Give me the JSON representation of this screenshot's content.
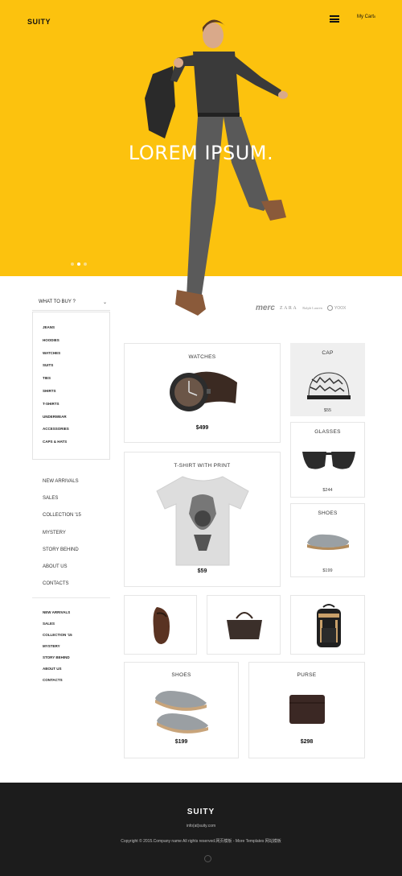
{
  "header": {
    "logo": "SUITY",
    "cart_label": "My Cart",
    "cart_count": "0"
  },
  "hero": {
    "title": "LOREM IPSUM.",
    "slides": 3,
    "active_slide": 2,
    "background_color": "#fcc20e"
  },
  "sidebar": {
    "dropdown_label": "WHAT TO BUY ?",
    "categories": [
      "JEANS",
      "HOODIES",
      "WATCHES",
      "SUITS",
      "TIES",
      "SHIRTS",
      "T-SHIRTS",
      "UNDERWEAR",
      "ACCESSORIES",
      "CAPS & HATS"
    ],
    "nav_main": [
      "NEW ARRIVALS",
      "SALES",
      "COLLECTION '15",
      "MYSTERY",
      "STORY BEHIND",
      "ABOUT US",
      "CONTACTS"
    ],
    "nav_secondary": [
      "NEW ARRIVALS",
      "SALES",
      "COLLECTION '15",
      "MYSTERY",
      "STORY BEHIND",
      "ABOUT US",
      "CONTACTS"
    ]
  },
  "brands": [
    "merc",
    "ZARA",
    "Ralph Lauren",
    "YOOX"
  ],
  "products": {
    "watches": {
      "title": "WATCHES",
      "price": "$499"
    },
    "cap": {
      "title": "CAP",
      "price": "$55"
    },
    "glasses": {
      "title": "GLASSES",
      "price": "$244"
    },
    "tshirt": {
      "title": "T-SHIRT WITH PRINT",
      "price": "$59"
    },
    "shoes_small": {
      "title": "SHOES",
      "price": "$199"
    },
    "shoes": {
      "title": "SHOES",
      "price": "$199"
    },
    "purse": {
      "title": "PURSE",
      "price": "$298"
    }
  },
  "footer": {
    "logo": "SUITY",
    "email": "info(at)suity.com",
    "copyright": "Copyright © 2015.Company name All rights reserved.网页模板 - More Templates 网站模板"
  }
}
